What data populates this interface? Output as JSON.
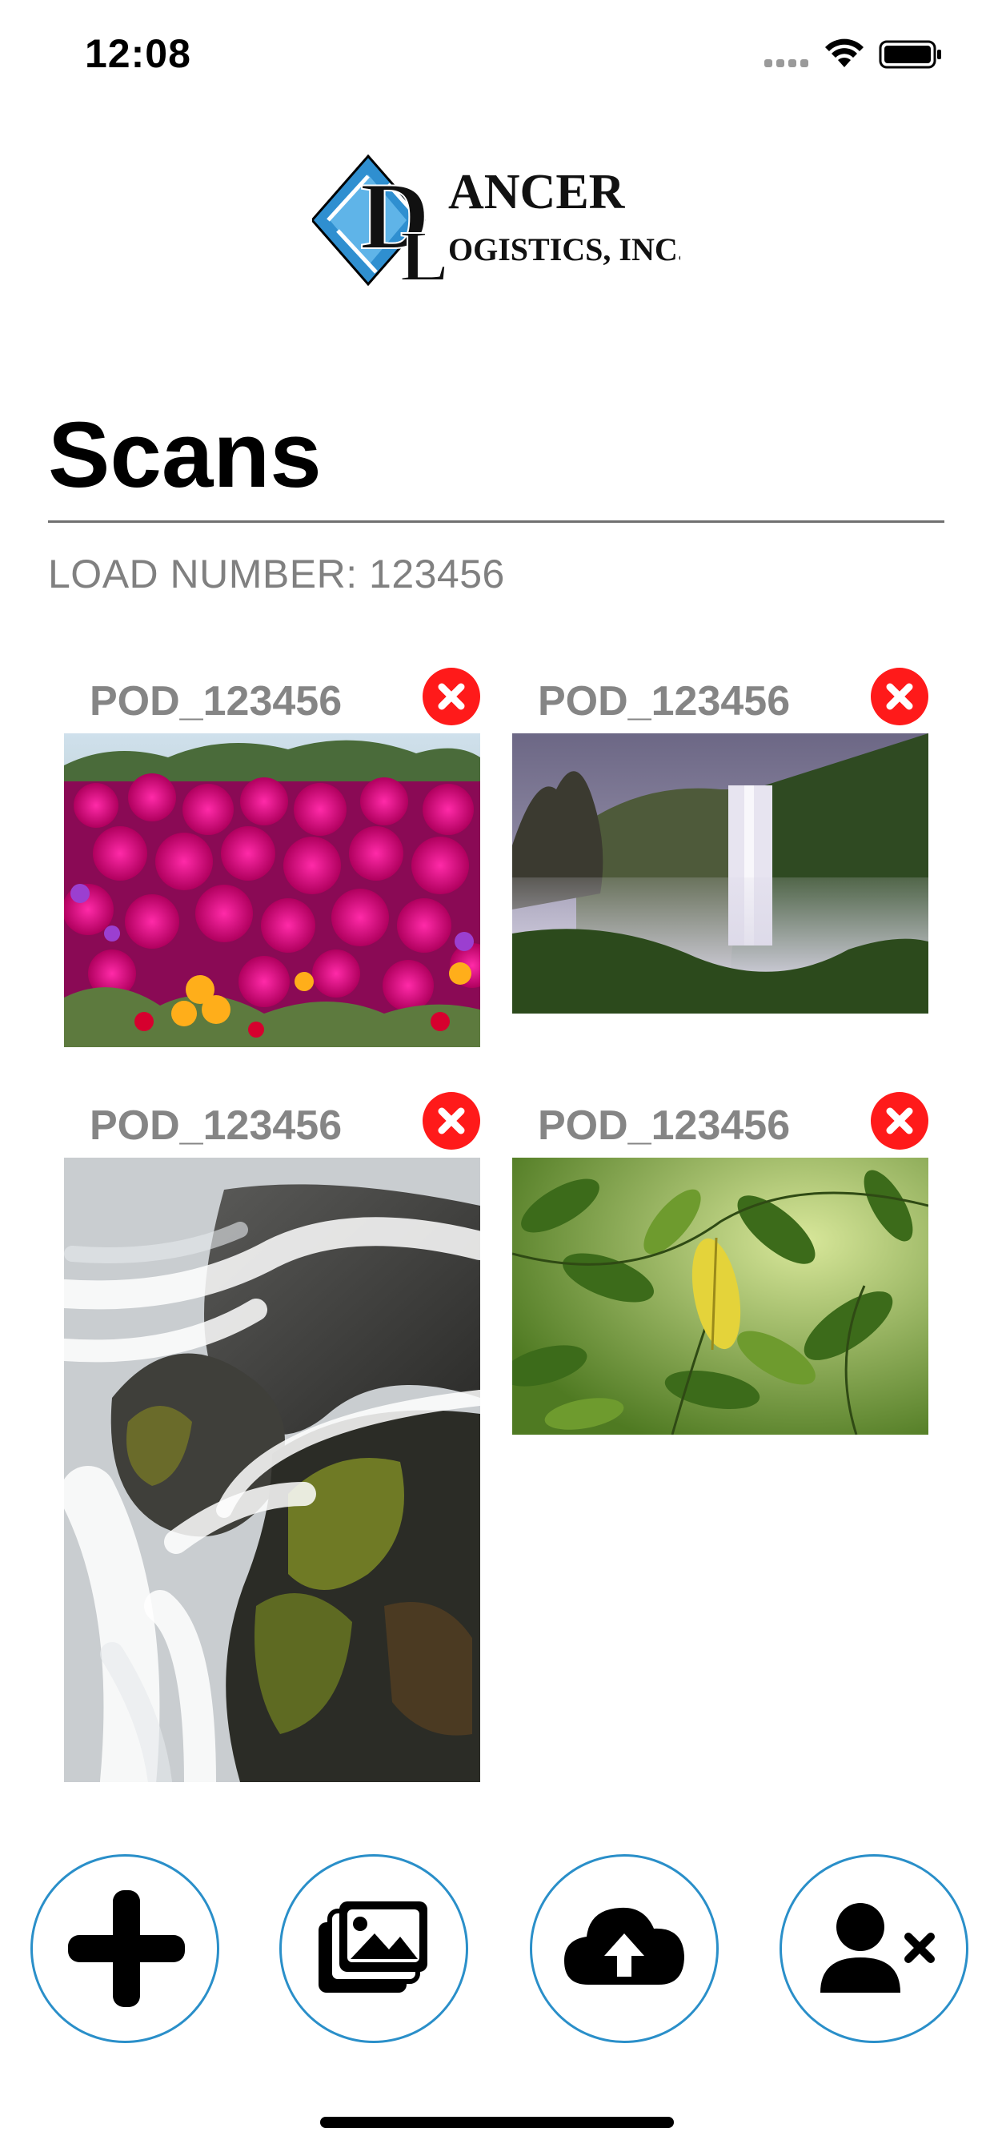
{
  "status_bar": {
    "time": "12:08"
  },
  "logo": {
    "line1": "DANCER",
    "line2": "OGISTICS, INC.",
    "monogram": "DL"
  },
  "page": {
    "title": "Scans",
    "load_number": "LOAD NUMBER: 123456"
  },
  "scans": [
    {
      "label": "POD_123456",
      "image": "pink flowers photo",
      "delete_icon": "close-icon"
    },
    {
      "label": "POD_123456",
      "image": "waterfall photo",
      "delete_icon": "close-icon"
    },
    {
      "label": "POD_123456",
      "image": "rocky cascade photo",
      "delete_icon": "close-icon"
    },
    {
      "label": "POD_123456",
      "image": "green leaves photo",
      "delete_icon": "close-icon"
    }
  ],
  "actions": [
    {
      "icon": "plus-icon"
    },
    {
      "icon": "gallery-icon"
    },
    {
      "icon": "cloud-upload-icon"
    },
    {
      "icon": "user-remove-icon"
    }
  ],
  "colors": {
    "accent_border": "#2a8fc9",
    "delete_red": "#ff1a1a",
    "label_gray": "#858585"
  }
}
